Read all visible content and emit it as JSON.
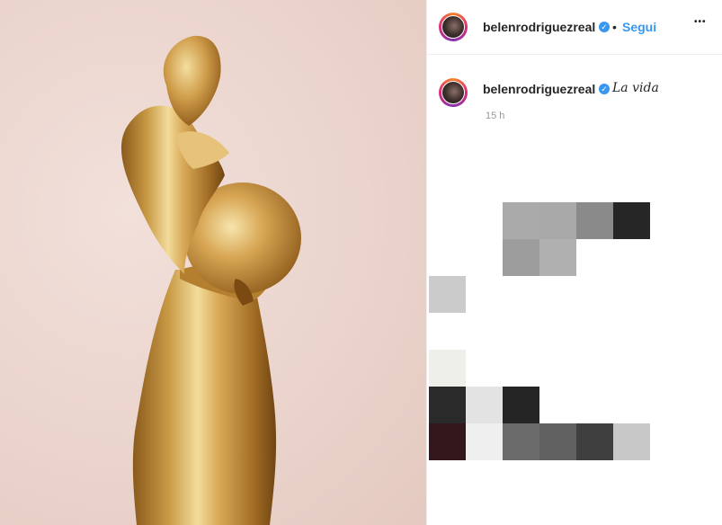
{
  "post": {
    "username": "belenrodriguezreal",
    "separator": "•",
    "follow_label": "Segui",
    "more_label": "•••",
    "caption": "La vida",
    "timestamp": "15 h"
  },
  "icons": {
    "verified": "verified-badge-icon",
    "more": "more-options-icon"
  },
  "colors": {
    "accent": "#3897f0",
    "text": "#262626",
    "muted": "#999999",
    "border": "#efefef"
  }
}
